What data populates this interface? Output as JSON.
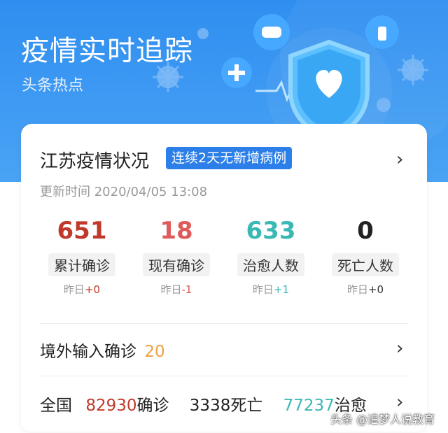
{
  "banner": {
    "title": "疫情实时追踪",
    "subtitle": "头条热点"
  },
  "card": {
    "region_title": "江苏疫情状况",
    "status_tag": "连续2天无新增病例",
    "update_time": "更新时间 2020/04/05 13:08",
    "stats": [
      {
        "value": "651",
        "label": "累计确诊",
        "delta_prefix": "昨日",
        "delta": "+0",
        "color": "#c0392b"
      },
      {
        "value": "18",
        "label": "现有确诊",
        "delta_prefix": "昨日",
        "delta": "-1",
        "color": "#e05a5a"
      },
      {
        "value": "633",
        "label": "治愈人数",
        "delta_prefix": "昨日",
        "delta": "+1",
        "color": "#3bb8b4"
      },
      {
        "value": "0",
        "label": "死亡人数",
        "delta_prefix": "昨日",
        "delta": "+0",
        "color": "#222222"
      }
    ],
    "imported": {
      "label": "境外输入确诊",
      "value": "20"
    },
    "national": {
      "label": "全国",
      "confirmed_value": "82930",
      "confirmed_label": "确诊",
      "deaths_value": "3338",
      "deaths_label": "死亡",
      "recovered_value": "77237",
      "recovered_label": "治愈"
    }
  },
  "watermark": "头条 @追梦人说教育",
  "chevron": "›"
}
